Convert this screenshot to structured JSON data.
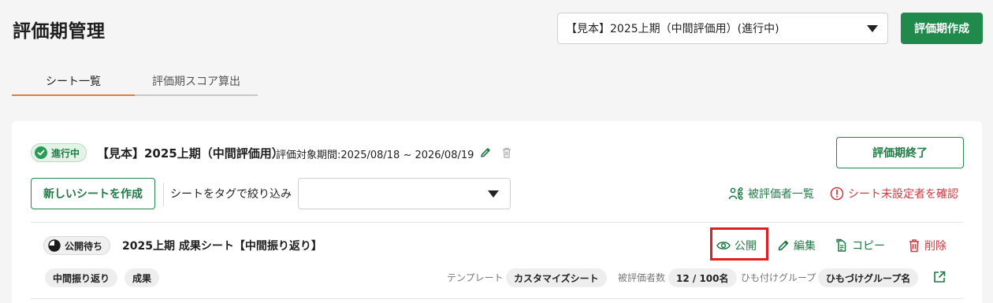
{
  "header": {
    "title": "評価期管理",
    "period_select_value": "【見本】2025上期（中間評価用）(進行中)",
    "create_button": "評価期作成"
  },
  "tabs": [
    {
      "label": "シート一覧",
      "active": true
    },
    {
      "label": "評価期スコア算出",
      "active": false
    }
  ],
  "period_card": {
    "status": "進行中",
    "title": "【見本】2025上期（中間評価用）",
    "range": "評価対象期間:2025/08/18 ~ 2026/08/19",
    "end_button": "評価期終了",
    "new_sheet_button": "新しいシートを作成",
    "filter_label": "シートをタグで絞り込み",
    "filter_value": "",
    "evaluatees_link": "被評価者一覧",
    "unset_link": "シート未設定者を確認"
  },
  "sheet": {
    "status": "公開待ち",
    "title": "2025上期 成果シート【中間振り返り】",
    "actions": {
      "publish": "公開",
      "edit": "編集",
      "copy": "コピー",
      "delete": "削除"
    },
    "tags": [
      "中間振り返り",
      "成果"
    ],
    "template_label": "テンプレート",
    "template_value": "カスタマイズシート",
    "evaluatee_count_label": "被評価者数",
    "evaluatee_count_value": "12 / 100名",
    "group_label": "ひも付けグループ",
    "group_value": "ひもづけグループ名"
  },
  "colors": {
    "primary": "#1f8a4c",
    "danger": "#d0383f",
    "tab_active": "#e07b3b",
    "highlight": "#e21e1e"
  }
}
